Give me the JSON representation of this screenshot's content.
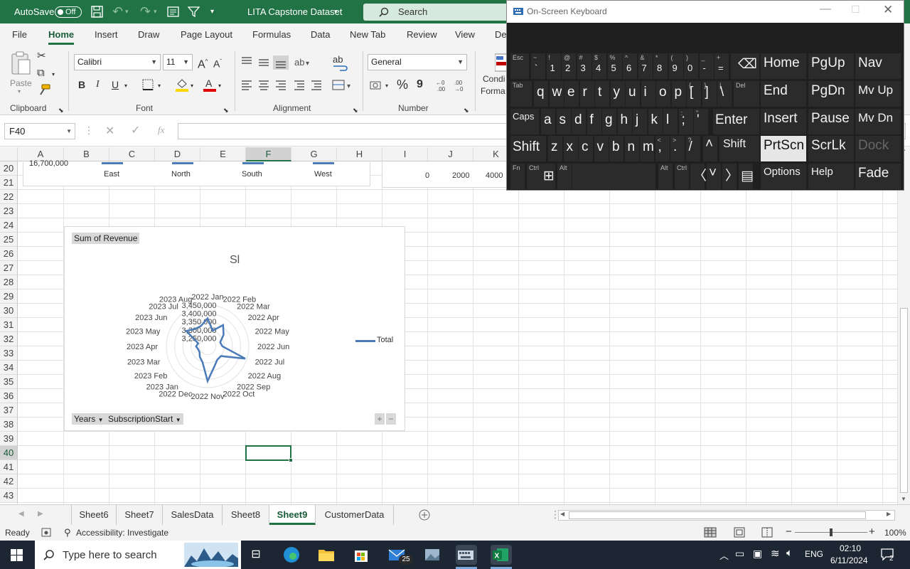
{
  "titlebar": {
    "autosave_label": "AutoSave",
    "autosave_state": "Off",
    "filename": "LITA Capstone Dataset",
    "search_placeholder": "Search"
  },
  "ribbon_tabs": [
    "File",
    "Home",
    "Insert",
    "Draw",
    "Page Layout",
    "Formulas",
    "Data",
    "New Tab",
    "Review",
    "View",
    "De"
  ],
  "active_ribbon_tab": "Home",
  "ribbon": {
    "clipboard": {
      "paste": "Paste",
      "label": "Clipboard"
    },
    "font": {
      "name": "Calibri",
      "size": "11",
      "label": "Font",
      "bold": "B",
      "italic": "I",
      "underline": "U"
    },
    "alignment": {
      "label": "Alignment"
    },
    "number": {
      "format": "General",
      "label": "Number",
      "percent": "%",
      "comma": "9"
    },
    "styles": {
      "line1": "Condi",
      "line2": "Forma"
    }
  },
  "formula_bar": {
    "name_box": "F40",
    "fx": "fx",
    "value": ""
  },
  "grid": {
    "columns": [
      "A",
      "B",
      "C",
      "D",
      "E",
      "F",
      "G",
      "H",
      "I",
      "J",
      "K"
    ],
    "rows": [
      "20",
      "21",
      "22",
      "23",
      "24",
      "25",
      "26",
      "27",
      "28",
      "29",
      "30",
      "31",
      "32",
      "33",
      "34",
      "35",
      "36",
      "37",
      "38",
      "39",
      "40",
      "41",
      "42",
      "43"
    ],
    "selected_cell": "F40",
    "selected_column": "F",
    "selected_row": "40"
  },
  "top_chart_fragment": {
    "axis_value": "16,700,000",
    "categories": [
      "East",
      "North",
      "South",
      "West"
    ]
  },
  "right_chart_fragment": {
    "ticks": [
      "0",
      "2000",
      "4000"
    ]
  },
  "radar_chart": {
    "field_button": "Sum of Revenue",
    "title": "Sl",
    "legend": "Total",
    "filter_buttons": [
      "Years",
      "SubscriptionStart"
    ],
    "zoom_plus": "+",
    "zoom_minus": "−"
  },
  "chart_data": {
    "type": "radar",
    "title": "Sl",
    "categories": [
      "2022 Jan",
      "2022 Feb",
      "2022 Mar",
      "2022 Apr",
      "2022 May",
      "2022 Jun",
      "2022 Jul",
      "2022 Aug",
      "2022 Sep",
      "2022 Oct",
      "2022 Nov",
      "2022 Dec",
      "2023 Jan",
      "2023 Feb",
      "2023 Mar",
      "2023 Apr",
      "2023 May",
      "2023 Jun",
      "2023 Jul",
      "2023 Aug"
    ],
    "radial_ticks": [
      "3,250,000",
      "3,300,000",
      "3,350,000",
      "3,400,000",
      "3,450,000"
    ],
    "radial_range": [
      3200000,
      3450000
    ],
    "series": [
      {
        "name": "Total",
        "values": [
          3370000,
          3300000,
          3360000,
          3320000,
          3280000,
          3290000,
          3440000,
          3300000,
          3300000,
          3330000,
          3410000,
          3300000,
          3280000,
          3260000,
          3260000,
          3270000,
          3260000,
          3360000,
          3330000,
          3330000
        ]
      }
    ],
    "legend": "right",
    "grid": true
  },
  "sheet_tabs": [
    "Sheet6",
    "Sheet7",
    "SalesData",
    "Sheet8",
    "Sheet9",
    "CustomerData"
  ],
  "active_sheet": "Sheet9",
  "statusbar": {
    "ready": "Ready",
    "accessibility": "Accessibility: Investigate",
    "zoom": "100%",
    "zoom_level": 0.5
  },
  "taskbar": {
    "search_placeholder": "Type here to search",
    "mail_badge": "25",
    "lang": "ENG",
    "time": "02:10",
    "date": "6/11/2024",
    "notifications": "2"
  },
  "osk": {
    "title": "On-Screen Keyboard",
    "keys": {
      "esc": "Esc",
      "tab": "Tab",
      "caps": "Caps",
      "shift": "Shift",
      "fn": "Fn",
      "ctrl": "Ctrl",
      "alt": "Alt",
      "del": "Del",
      "enter": "Enter",
      "home": "Home",
      "pgup": "PgUp",
      "nav": "Nav",
      "end": "End",
      "pgdn": "PgDn",
      "mvup": "Mv Up",
      "insert": "Insert",
      "pause": "Pause",
      "mvdn": "Mv Dn",
      "prtscn": "PrtScn",
      "scrlk": "ScrLk",
      "dock": "Dock",
      "options": "Options",
      "help": "Help",
      "fade": "Fade"
    },
    "row1": [
      {
        "m": "`",
        "s": "~"
      },
      {
        "m": "1",
        "s": "!"
      },
      {
        "m": "2",
        "s": "@"
      },
      {
        "m": "3",
        "s": "#"
      },
      {
        "m": "4",
        "s": "$"
      },
      {
        "m": "5",
        "s": "%"
      },
      {
        "m": "6",
        "s": "^"
      },
      {
        "m": "7",
        "s": "&"
      },
      {
        "m": "8",
        "s": "*"
      },
      {
        "m": "9",
        "s": "("
      },
      {
        "m": "0",
        "s": ")"
      },
      {
        "m": "-",
        "s": "_"
      },
      {
        "m": "=",
        "s": "+"
      }
    ],
    "row2": [
      {
        "m": "q",
        "s": ""
      },
      {
        "m": "w",
        "s": ""
      },
      {
        "m": "e",
        "s": ""
      },
      {
        "m": "r",
        "s": ""
      },
      {
        "m": "t",
        "s": ""
      },
      {
        "m": "y",
        "s": ""
      },
      {
        "m": "u",
        "s": ""
      },
      {
        "m": "i",
        "s": ""
      },
      {
        "m": "o",
        "s": ""
      },
      {
        "m": "p",
        "s": ""
      },
      {
        "m": "[",
        "s": "{"
      },
      {
        "m": "]",
        "s": "}"
      },
      {
        "m": "\\",
        "s": "|"
      }
    ],
    "row3": [
      {
        "m": "a",
        "s": ""
      },
      {
        "m": "s",
        "s": ""
      },
      {
        "m": "d",
        "s": ""
      },
      {
        "m": "f",
        "s": ""
      },
      {
        "m": "g",
        "s": ""
      },
      {
        "m": "h",
        "s": ""
      },
      {
        "m": "j",
        "s": ""
      },
      {
        "m": "k",
        "s": ""
      },
      {
        "m": "l",
        "s": ""
      },
      {
        "m": ";",
        "s": ":"
      },
      {
        "m": "'",
        "s": "\""
      }
    ],
    "row4": [
      {
        "m": "z",
        "s": ""
      },
      {
        "m": "x",
        "s": ""
      },
      {
        "m": "c",
        "s": ""
      },
      {
        "m": "v",
        "s": ""
      },
      {
        "m": "b",
        "s": ""
      },
      {
        "m": "n",
        "s": ""
      },
      {
        "m": "m",
        "s": ""
      },
      {
        "m": ",",
        "s": "<"
      },
      {
        "m": ".",
        "s": ">"
      },
      {
        "m": "/",
        "s": "?"
      }
    ]
  }
}
